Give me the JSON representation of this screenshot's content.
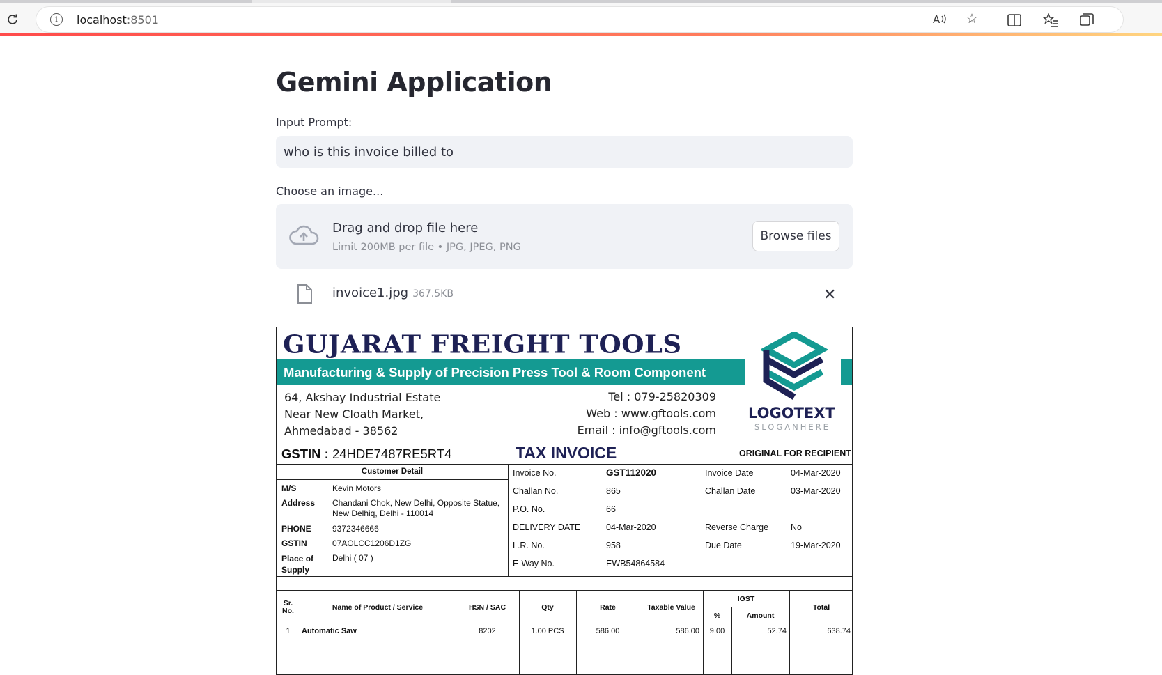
{
  "browser": {
    "url_host": "localhost",
    "url_port": ":8501"
  },
  "app": {
    "title": "Gemini Application",
    "prompt_label": "Input Prompt:",
    "prompt_value": "who is this invoice billed to",
    "uploader_label": "Choose an image...",
    "dropzone_title": "Drag and drop file here",
    "dropzone_limit": "Limit 200MB per file • JPG, JPEG, PNG",
    "browse_label": "Browse files",
    "file_name": "invoice1.jpg",
    "file_size": "367.5KB"
  },
  "invoice": {
    "company": "GUJARAT FREIGHT TOOLS",
    "tagline": "Manufacturing & Supply of Precision Press Tool & Room Component",
    "address": [
      "64, Akshay Industrial Estate",
      "Near New Cloath Market,",
      "Ahmedabad - 38562"
    ],
    "contact": [
      "Tel : 079-25820309",
      "Web : www.gftools.com",
      "Email : info@gftools.com"
    ],
    "logo_text": "LOGOTEXT",
    "logo_slogan": "SLOGANHERE",
    "gstin_label": "GSTIN :",
    "gstin_value": "24HDE7487RE5RT4",
    "doc_title": "TAX INVOICE",
    "copy_label": "ORIGINAL FOR RECIPIENT",
    "customer_head": "Customer Detail",
    "customer": {
      "ms_label": "M/S",
      "ms": "Kevin Motors",
      "address_label": "Address",
      "address": "Chandani Chok, New Delhi, Opposite Statue, New Delhiq, Delhi - 110014",
      "phone_label": "PHONE",
      "phone": "9372346666",
      "gstin_label": "GSTIN",
      "gstin": "07AOLCC1206D1ZG",
      "pos_label": "Place of Supply",
      "pos": "Delhi ( 07 )"
    },
    "meta": {
      "invoice_no_label": "Invoice No.",
      "invoice_no": "GST112020",
      "invoice_date_label": "Invoice Date",
      "invoice_date": "04-Mar-2020",
      "challan_no_label": "Challan No.",
      "challan_no": "865",
      "challan_date_label": "Challan Date",
      "challan_date": "03-Mar-2020",
      "po_label": "P.O. No.",
      "po": "66",
      "delivery_label": "DELIVERY DATE",
      "delivery": "04-Mar-2020",
      "reverse_label": "Reverse Charge",
      "reverse": "No",
      "lr_label": "L.R. No.",
      "lr": "958",
      "due_label": "Due Date",
      "due": "19-Mar-2020",
      "eway_label": "E-Way No.",
      "eway": "EWB54864584"
    },
    "table_headers": {
      "sr": "Sr. No.",
      "name": "Name of Product / Service",
      "hsn": "HSN / SAC",
      "qty": "Qty",
      "rate": "Rate",
      "taxable": "Taxable Value",
      "igst": "IGST",
      "pct": "%",
      "amount": "Amount",
      "total": "Total"
    },
    "first_row": {
      "sr": "1",
      "name": "Automatic Saw",
      "hsn": "8202",
      "qty": "1.00 PCS",
      "rate": "586.00",
      "taxable": "586.00",
      "pct": "9.00",
      "amount": "52.74",
      "total": "638.74"
    }
  }
}
